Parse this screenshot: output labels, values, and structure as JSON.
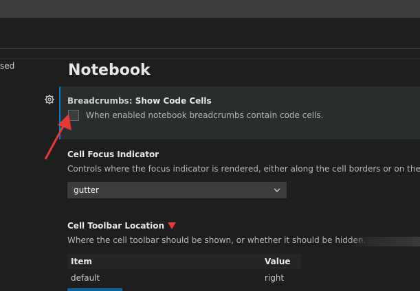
{
  "toc": {
    "partial_label": "sed"
  },
  "section": {
    "title": "Notebook"
  },
  "settings": {
    "breadcrumbs": {
      "category": "Breadcrumbs: ",
      "name": "Show Code Cells",
      "description": "When enabled notebook breadcrumbs contain code cells.",
      "checked": false
    },
    "focus_indicator": {
      "name": "Cell Focus Indicator",
      "description": "Controls where the focus indicator is rendered, either along the cell borders or on the left",
      "value": "gutter"
    },
    "toolbar_location": {
      "name": "Cell Toolbar Location",
      "description": "Where the cell toolbar should be shown, or whether it should be hidden.",
      "table": {
        "headers": [
          "Item",
          "Value"
        ],
        "rows": [
          [
            "default",
            "right"
          ]
        ]
      }
    }
  },
  "colors": {
    "accent": "#007acc",
    "annotation": "#e53935"
  },
  "icons": {
    "gear": "gear-icon",
    "chevron": "chevron-down-icon",
    "arrow": "annotation-arrow-icon"
  }
}
